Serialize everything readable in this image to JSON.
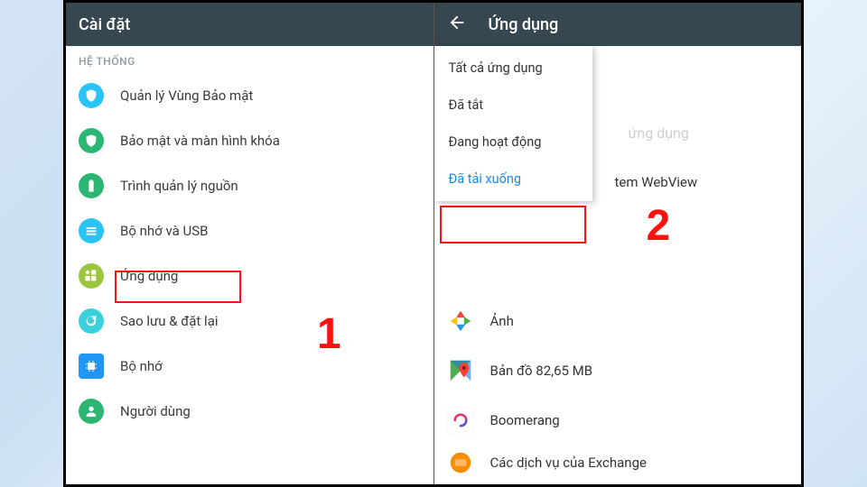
{
  "left": {
    "title": "Cài đặt",
    "section": "HỆ THỐNG",
    "items": [
      {
        "icon": "shield-cog",
        "color": "#29c4f5",
        "label": "Quản lý Vùng Bảo mật"
      },
      {
        "icon": "shield",
        "color": "#2bb673",
        "label": "Bảo mật và màn hình khóa"
      },
      {
        "icon": "battery",
        "color": "#2bb673",
        "label": "Trình quản lý nguồn"
      },
      {
        "icon": "storage",
        "color": "#29c4f5",
        "label": "Bộ nhớ và USB"
      },
      {
        "icon": "apps",
        "color": "#9bc53d",
        "label": "Ứng dụng"
      },
      {
        "icon": "backup",
        "color": "#3ad0db",
        "label": "Sao lưu & đặt lại"
      },
      {
        "icon": "chip",
        "color": "#2196f3",
        "label": "Bộ nhớ"
      },
      {
        "icon": "user",
        "color": "#2bb673",
        "label": "Người dùng"
      }
    ],
    "callout": "1"
  },
  "right": {
    "title": "Ứng dụng",
    "filter": [
      "Tất cả ứng dụng",
      "Đã tắt",
      "Đang hoạt động",
      "Đã tải xuống"
    ],
    "ghost1": "ứng dụng",
    "ghost2": "tem WebView",
    "apps": [
      {
        "icon": "photos",
        "label": "Ảnh",
        "sub": ""
      },
      {
        "icon": "maps",
        "label": "Bản đồ",
        "sub": "82,65 MB"
      },
      {
        "icon": "boomerang",
        "label": "Boomerang",
        "sub": ""
      },
      {
        "icon": "exchange",
        "label": "Các dịch vụ của Exchange",
        "sub": ""
      }
    ],
    "callout": "2"
  }
}
